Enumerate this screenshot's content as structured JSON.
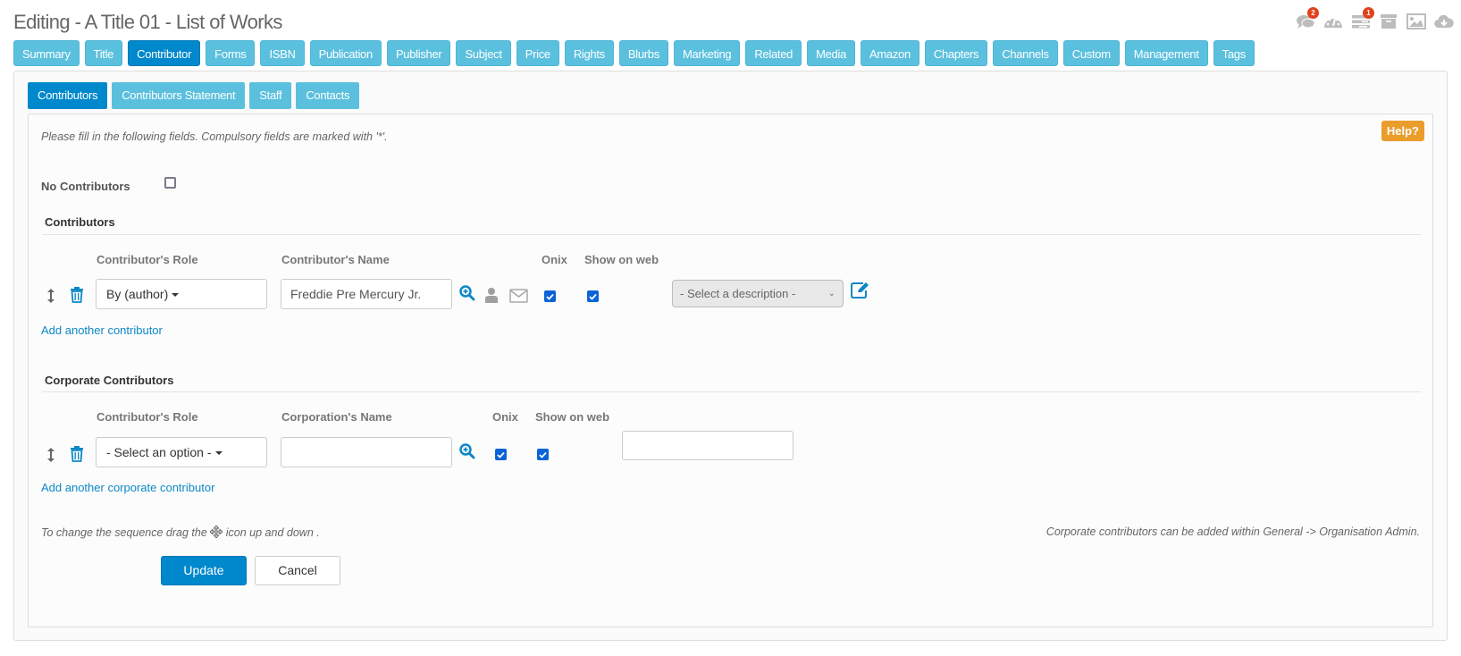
{
  "page": {
    "title": "Editing - A Title 01 - List of Works"
  },
  "top_icons": [
    {
      "name": "comments-icon",
      "badge": "2"
    },
    {
      "name": "dashboard-icon",
      "badge": null
    },
    {
      "name": "tasks-icon",
      "badge": "1"
    },
    {
      "name": "archive-icon",
      "badge": null
    },
    {
      "name": "image-icon",
      "badge": null
    },
    {
      "name": "cloud-download-icon",
      "badge": null
    }
  ],
  "main_tabs": [
    "Summary",
    "Title",
    "Contributor",
    "Forms",
    "ISBN",
    "Publication",
    "Publisher",
    "Subject",
    "Price",
    "Rights",
    "Blurbs",
    "Marketing",
    "Related",
    "Media",
    "Amazon",
    "Chapters",
    "Channels",
    "Custom",
    "Management",
    "Tags"
  ],
  "main_tab_active": "Contributor",
  "sub_tabs": [
    "Contributors",
    "Contributors Statement",
    "Staff",
    "Contacts"
  ],
  "sub_tab_active": "Contributors",
  "form": {
    "hint": "Please fill in the following fields. Compulsory fields are marked with '*'.",
    "help_label": "Help?",
    "no_contributors_label": "No Contributors",
    "no_contributors_checked": false
  },
  "contributors": {
    "title": "Contributors",
    "headers": {
      "role": "Contributor's Role",
      "name": "Contributor's Name",
      "onix": "Onix",
      "web": "Show on web"
    },
    "rows": [
      {
        "role": "By (author)",
        "name": "Freddie Pre Mercury Jr.",
        "onix": true,
        "web": true,
        "description": "- Select a description -"
      }
    ],
    "add_link": "Add another contributor"
  },
  "corporate": {
    "title": "Corporate Contributors",
    "headers": {
      "role": "Contributor's Role",
      "name": "Corporation's Name",
      "onix": "Onix",
      "web": "Show on web"
    },
    "rows": [
      {
        "role": "- Select an option -",
        "name": "",
        "onix": true,
        "web": true,
        "description": ""
      }
    ],
    "add_link": "Add another corporate contributor"
  },
  "footer": {
    "sequence_note_before": "To change the sequence drag the",
    "sequence_note_after": "icon up and down .",
    "corporate_note": "Corporate contributors can be added within General -> Organisation Admin.",
    "update_label": "Update",
    "cancel_label": "Cancel"
  },
  "colors": {
    "primary": "#0088cc",
    "tab": "#5bc0de",
    "help": "#eb9d2b",
    "badge": "#e0421c",
    "checkbox": "#0b63d6"
  }
}
